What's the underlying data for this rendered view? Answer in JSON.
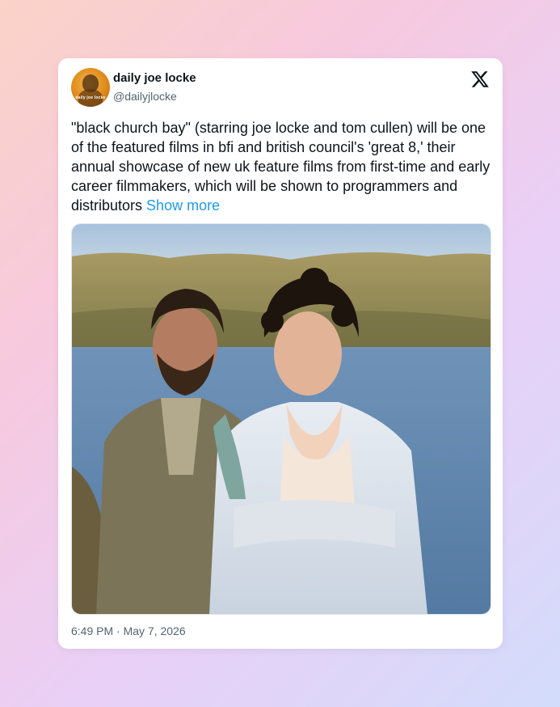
{
  "author": {
    "display_name": "daily joe locke",
    "handle": "@dailyjlocke",
    "avatar_text": "daily joe locke"
  },
  "tweet": {
    "text": "\"black church bay\" (starring joe locke and tom cullen) will be one of the featured films in bfi and british council's 'great 8,' their annual showcase of new uk feature films from first-time and early career filmmakers, which will be shown to programmers and distributors",
    "show_more": "Show more",
    "timestamp": "6:49 PM · May 7, 2026"
  },
  "icons": {
    "platform_logo": "x-logo-icon"
  }
}
